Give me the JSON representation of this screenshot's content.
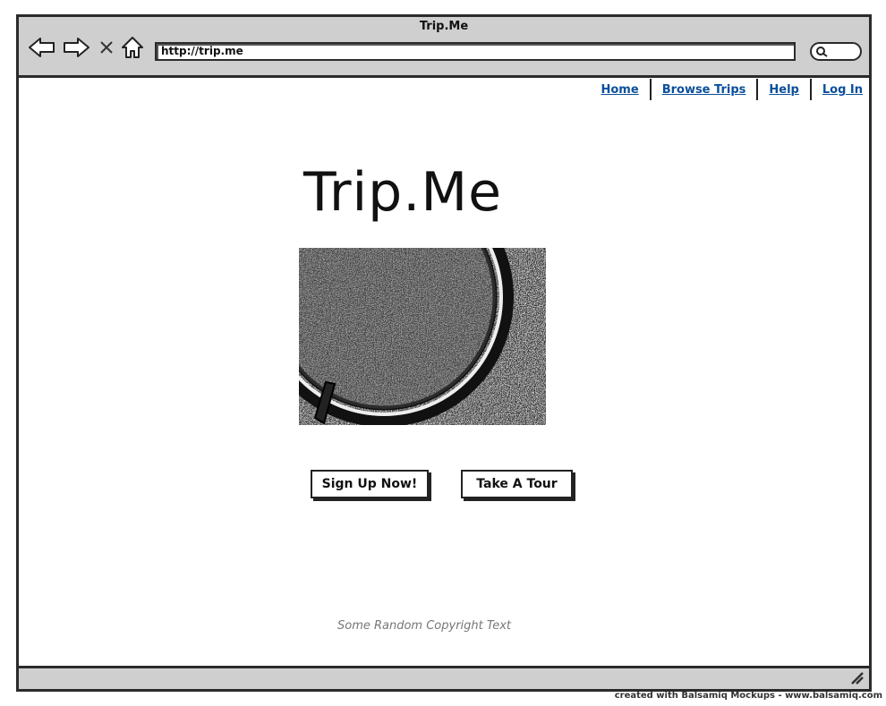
{
  "window": {
    "title": "Trip.Me"
  },
  "browser": {
    "url": "http://trip.me",
    "icons": [
      "back-arrow-icon",
      "forward-arrow-icon",
      "stop-icon",
      "home-icon",
      "search-icon",
      "resize-grip-icon"
    ]
  },
  "nav": {
    "home": "Home",
    "browse": "Browse Trips",
    "help": "Help",
    "login": "Log In"
  },
  "hero": {
    "title": "Trip.Me",
    "image": "globe-image"
  },
  "actions": {
    "signup": "Sign Up Now!",
    "tour": "Take A Tour"
  },
  "footer": {
    "copyright": "Some Random Copyright Text"
  },
  "watermark": "created with Balsamiq Mockups - www.balsamiq.com",
  "colors": {
    "link": "#0a4f9a",
    "chrome": "#cfcfcf",
    "border": "#2b2b2b"
  }
}
